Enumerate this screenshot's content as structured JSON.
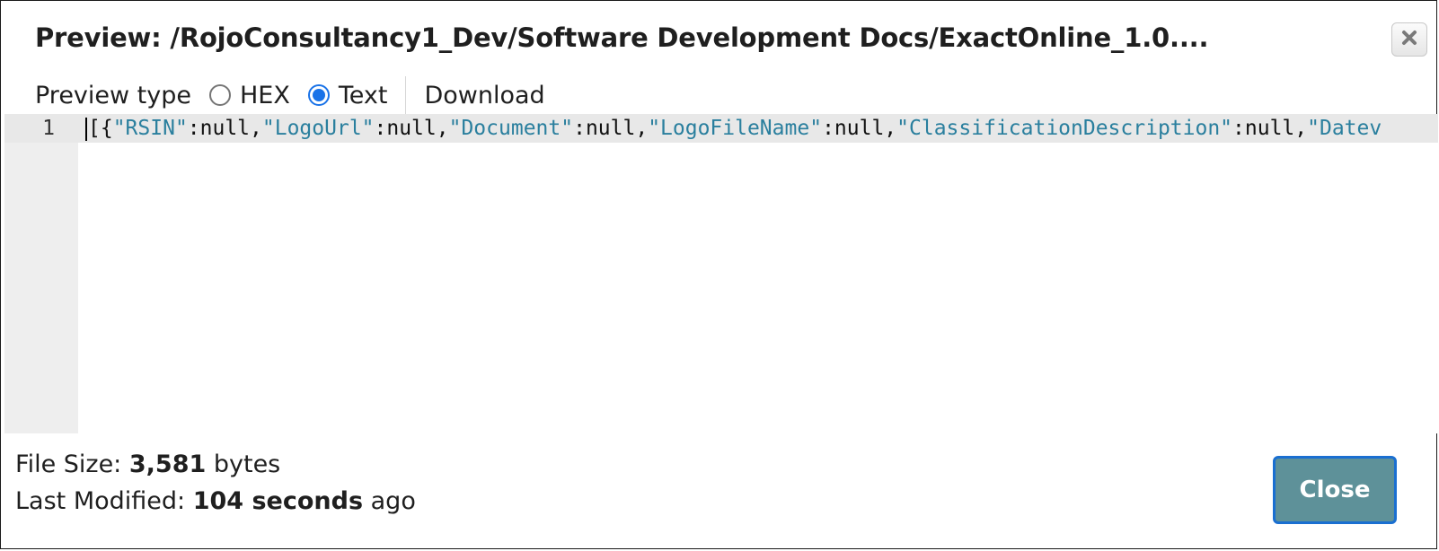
{
  "dialog": {
    "title": "Preview: /RojoConsultancy1_Dev/Software Development Docs/ExactOnline_1.0....",
    "close_icon": "close-x-icon"
  },
  "toolbar": {
    "preview_type_label": "Preview type",
    "options": [
      {
        "label": "HEX",
        "selected": false
      },
      {
        "label": "Text",
        "selected": true
      }
    ],
    "download_label": "Download"
  },
  "editor": {
    "line_number": "1",
    "tokens": [
      {
        "text": "[{",
        "kind": "punct"
      },
      {
        "text": "\"RSIN\"",
        "kind": "key"
      },
      {
        "text": ":null,",
        "kind": "punct"
      },
      {
        "text": "\"LogoUrl\"",
        "kind": "key"
      },
      {
        "text": ":null,",
        "kind": "punct"
      },
      {
        "text": "\"Document\"",
        "kind": "key"
      },
      {
        "text": ":null,",
        "kind": "punct"
      },
      {
        "text": "\"LogoFileName\"",
        "kind": "key"
      },
      {
        "text": ":null,",
        "kind": "punct"
      },
      {
        "text": "\"ClassificationDescription\"",
        "kind": "key"
      },
      {
        "text": ":null,",
        "kind": "punct"
      },
      {
        "text": "\"Datev",
        "kind": "key"
      }
    ]
  },
  "footer": {
    "file_size_label": "File Size: ",
    "file_size_value": "3,581",
    "file_size_unit": " bytes",
    "modified_label": "Last Modified: ",
    "modified_value": "104 seconds",
    "modified_suffix": " ago"
  },
  "buttons": {
    "close_label": "Close"
  },
  "colors": {
    "json_key": "#2a7f9e",
    "close_button_bg": "#5e9199",
    "focus_ring": "#1a6fd1",
    "radio_selected": "#1a73e8"
  }
}
